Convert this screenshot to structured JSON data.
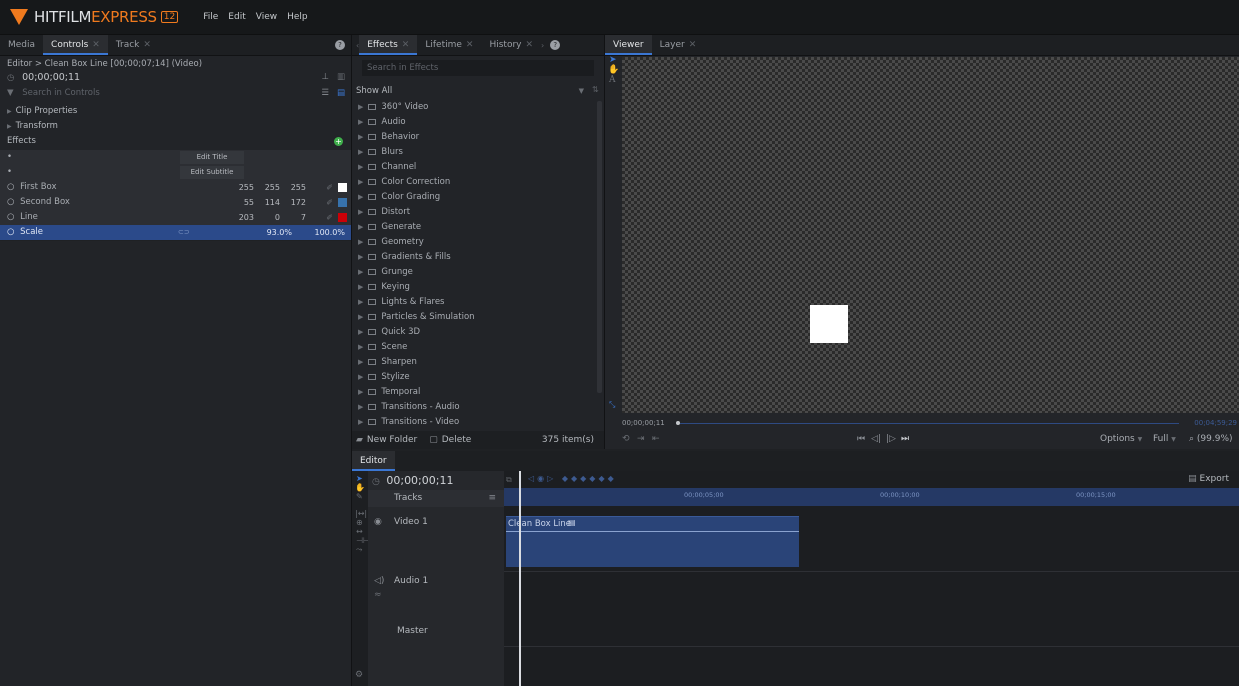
{
  "app": {
    "logo_a": "HITFILM",
    "logo_b": "EXPRESS",
    "logo_badge": "12",
    "menu": [
      "File",
      "Edit",
      "View",
      "Help"
    ]
  },
  "controls_panel": {
    "tabs": [
      "Media",
      "Controls",
      "Track"
    ],
    "breadcrumb": "Editor > Clean Box Line [00;00;07;14] (Video)",
    "timecode": "00;00;00;11",
    "search_placeholder": "Search in Controls",
    "sections": [
      "Clip Properties",
      "Transform",
      "Effects"
    ],
    "bullets": [
      {
        "label": "Edit Title"
      },
      {
        "label": "Edit Subtitle"
      }
    ],
    "rows": [
      {
        "name": "First Box",
        "r": "255",
        "g": "255",
        "b": "255",
        "color": "#ffffff"
      },
      {
        "name": "Second Box",
        "r": "55",
        "g": "114",
        "b": "172",
        "color": "#3772ac"
      },
      {
        "name": "Line",
        "r": "203",
        "g": "0",
        "b": "7",
        "color": "#cb0007"
      }
    ],
    "scale": {
      "name": "Scale",
      "v1": "93.0%",
      "v2": "100.0%"
    },
    "accent_color": "#3b77d4"
  },
  "effects_panel": {
    "tabs": [
      "Effects",
      "Lifetime",
      "History"
    ],
    "search_placeholder": "Search in Effects",
    "filter": "Show All",
    "items": [
      "360° Video",
      "Audio",
      "Behavior",
      "Blurs",
      "Channel",
      "Color Correction",
      "Color Grading",
      "Distort",
      "Generate",
      "Geometry",
      "Gradients & Fills",
      "Grunge",
      "Keying",
      "Lights & Flares",
      "Particles & Simulation",
      "Quick 3D",
      "Scene",
      "Sharpen",
      "Stylize",
      "Temporal",
      "Transitions - Audio",
      "Transitions - Video"
    ],
    "new_folder": "New Folder",
    "delete": "Delete",
    "count": "375 item(s)"
  },
  "viewer_panel": {
    "tabs": [
      "Viewer",
      "Layer"
    ],
    "timecode": "00;00;00;11",
    "end_time": "00;04;59;29",
    "options": "Options",
    "quality": "Full",
    "zoom": "(99.9%)"
  },
  "editor_panel": {
    "tab": "Editor",
    "timecode": "00;00;00;11",
    "tracks_label": "Tracks",
    "export_label": "Export",
    "ruler_ticks": [
      "00;00;05;00",
      "00;00;10;00",
      "00;00;15;00"
    ],
    "video_track": "Video 1",
    "audio_track": "Audio 1",
    "master": "Master",
    "clip_name": "Clean Box Line"
  }
}
